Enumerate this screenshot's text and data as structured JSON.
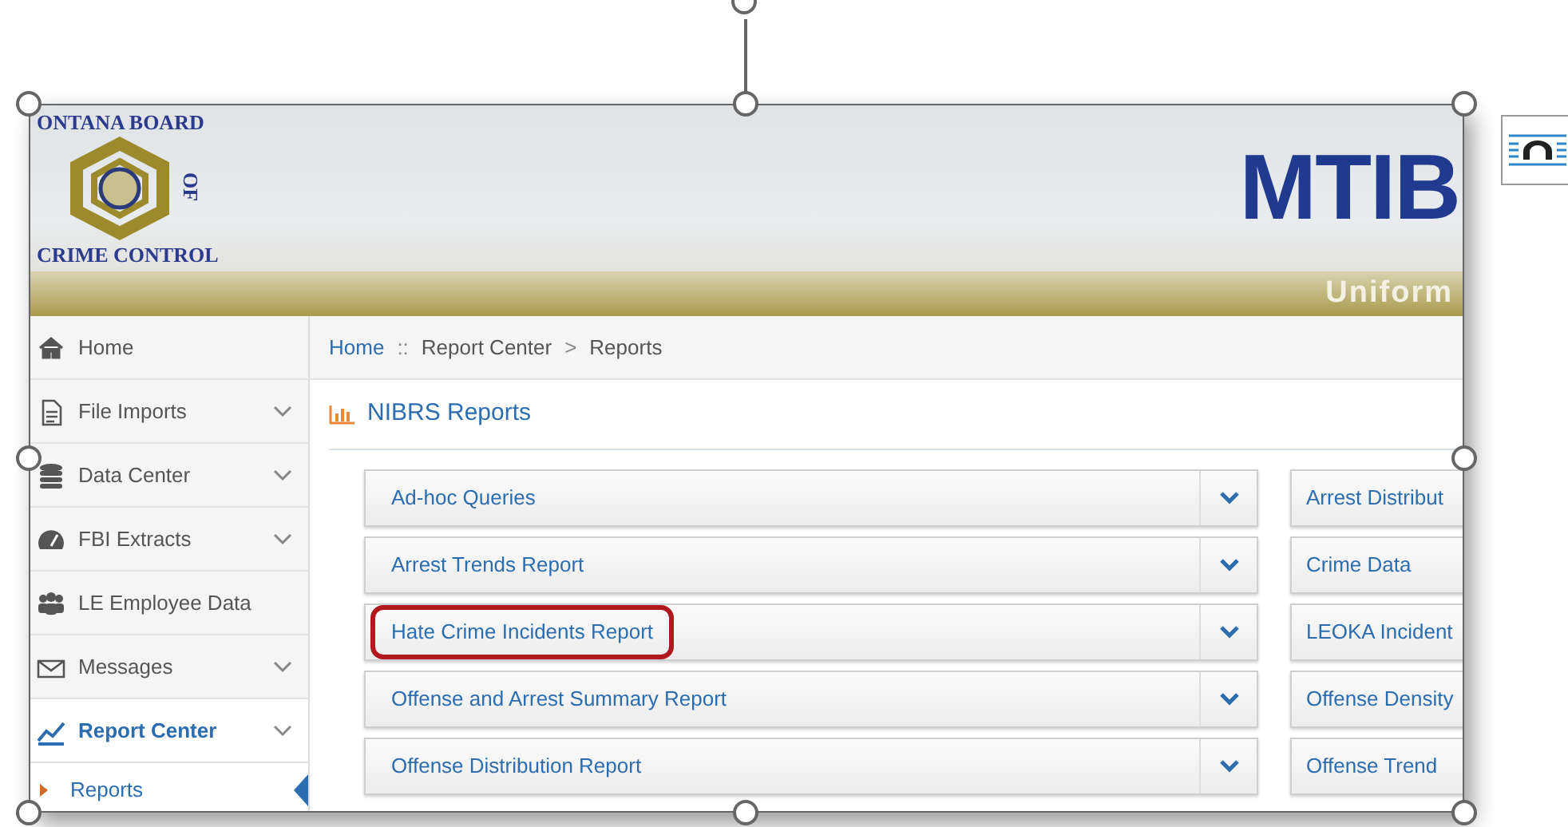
{
  "image": {
    "banner": {
      "logo_text_top": "ONTANA BOARD",
      "logo_text_side": "OF",
      "logo_text_bottom": "CRIME CONTROL",
      "title": "MTIB",
      "subtitle": "Uniform"
    },
    "sidebar": {
      "items": [
        {
          "label": "Home",
          "has_submenu": false,
          "selected": false
        },
        {
          "label": "File Imports",
          "has_submenu": true,
          "selected": false
        },
        {
          "label": "Data Center",
          "has_submenu": true,
          "selected": false
        },
        {
          "label": "FBI Extracts",
          "has_submenu": true,
          "selected": false
        },
        {
          "label": "LE Employee Data",
          "has_submenu": false,
          "selected": false
        },
        {
          "label": "Messages",
          "has_submenu": true,
          "selected": false
        },
        {
          "label": "Report Center",
          "has_submenu": true,
          "selected": true,
          "children": [
            {
              "label": "Reports",
              "selected": true
            }
          ]
        }
      ]
    },
    "breadcrumb": [
      {
        "label": "Home",
        "link": true
      },
      {
        "label": "Report Center",
        "link": false,
        "separator_before": "::"
      },
      {
        "label": "Reports",
        "link": false,
        "separator_before": ">"
      }
    ],
    "section_title": "NIBRS Reports",
    "reports_left": [
      {
        "label": "Ad-hoc Queries",
        "highlighted": false
      },
      {
        "label": "Arrest Trends Report",
        "highlighted": false
      },
      {
        "label": "Hate Crime Incidents Report",
        "highlighted": true
      },
      {
        "label": "Offense and Arrest Summary Report",
        "highlighted": false
      },
      {
        "label": "Offense Distribution Report",
        "highlighted": false
      }
    ],
    "reports_right": [
      {
        "label": "Arrest Distribut"
      },
      {
        "label": "Crime Data"
      },
      {
        "label": "LEOKA Incident"
      },
      {
        "label": "Offense Density"
      },
      {
        "label": "Offense Trend"
      }
    ]
  }
}
